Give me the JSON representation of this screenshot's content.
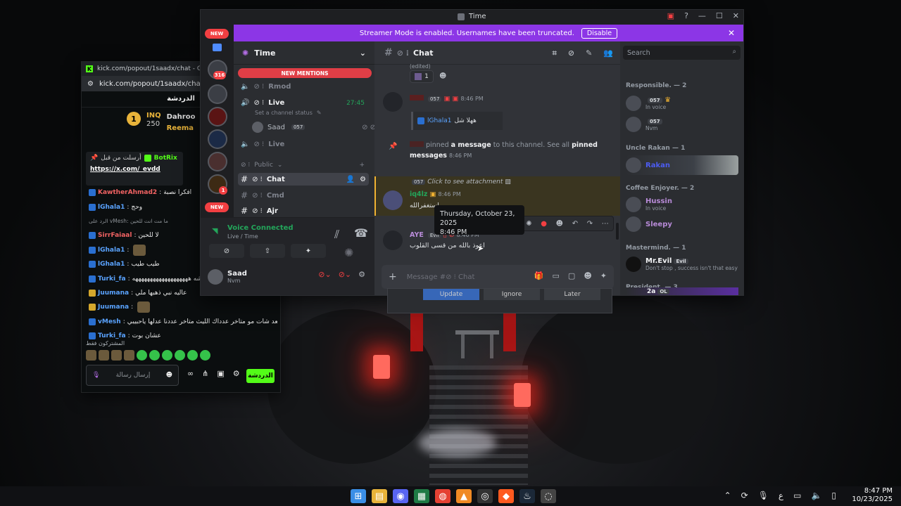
{
  "desktop": {
    "taskbar": {
      "icons": [
        "windows-start",
        "file-explorer",
        "discord",
        "excel",
        "chrome",
        "app-orange",
        "obs",
        "brave",
        "steam",
        "app-other"
      ],
      "tray": {
        "lang": "ع",
        "time": "8:47 PM",
        "date": "10/23/2025"
      }
    }
  },
  "kick": {
    "window_title": "kick.com/popout/1saadx/chat - Google Ch",
    "url": "kick.com/popout/1saadx/chat",
    "header": "الدردشة",
    "leaderboard": [
      {
        "rank": "1",
        "name": "INQ",
        "points": "250"
      },
      {
        "name": "Dahroo"
      },
      {
        "name": "Reema"
      }
    ],
    "pinned": {
      "from_label": "أرسلت من قبل",
      "user": "BotRix",
      "link": "https://x.com/_evdd"
    },
    "messages": [
      {
        "user": "KawtherAhmad2",
        "text": "افكرا نصبة",
        "color": "#f26363"
      },
      {
        "user": "lGhala1",
        "text": "وحج",
        "color": "#5aa3ff"
      },
      {
        "reply": "الرد على vMesh: ما مت انت للحين"
      },
      {
        "user": "SirrFaiaal",
        "text": "لا للحين",
        "color": "#f26363"
      },
      {
        "user": "lGhala1",
        "text": "",
        "color": "#5aa3ff"
      },
      {
        "user": "lGhala1",
        "text": "طيب طيب",
        "color": "#5aa3ff"
      },
      {
        "user": "Turki_fa",
        "text": "عايشه هههههههههههههههههههه",
        "color": "#5aa3ff"
      },
      {
        "user": "Juumana",
        "text": "عاليه نبي ذهبها ملي",
        "color": "#5aa3ff"
      },
      {
        "user": "Juumana",
        "text": "",
        "color": "#5aa3ff"
      },
      {
        "user": "vMesh",
        "text": "ياسعد شات مو متاخر عدداك الليث متاخر عددنا عدلها ياحبيبي",
        "color": "#5aa3ff"
      },
      {
        "user": "Turki_fa",
        "text": "عشان بوت",
        "color": "#5aa3ff"
      }
    ],
    "emotes_label": "المشتركون فقط",
    "input_placeholder": "إرسال رسالة",
    "send_label": "الدردشة"
  },
  "discord": {
    "title": "Time",
    "banner": {
      "text": "Streamer Mode is enabled. Usernames have been truncated.",
      "button": "Disable"
    },
    "guild_badges": {
      "new_top": "NEW",
      "count": "316",
      "red": "1",
      "new_bottom": "NEW"
    },
    "server_name": "Time",
    "new_mentions": "NEW MENTIONS",
    "channels": [
      {
        "name": "Rmod",
        "type": "voice"
      },
      {
        "name": "Live",
        "type": "voice",
        "time": "27:45",
        "status": "Set a channel status"
      },
      {
        "name": "Live",
        "type": "voice"
      },
      {
        "category": "Public"
      },
      {
        "name": "Chat",
        "type": "text",
        "active": true
      },
      {
        "name": "Cmd",
        "type": "text"
      },
      {
        "name": "Ajr",
        "type": "text"
      }
    ],
    "voice_member": {
      "name": "Saad",
      "tag": "057"
    },
    "voice": {
      "status": "Voice Connected",
      "channel": "Live / Time"
    },
    "user": {
      "name": "Saad",
      "status": "Nvm"
    },
    "chat": {
      "channel": "Chat",
      "edited": "(edited)",
      "reaction_count": "1",
      "messages": [
        {
          "tag": "057",
          "time": "8:46 PM",
          "reply_user": "lGhala1",
          "reply_text": "ههلا شل"
        },
        {
          "system": "pinned",
          "text_a": " pinned ",
          "text_b": "a message",
          "text_c": " to this channel. See all ",
          "text_d": "pinned",
          "text_e": "messages",
          "time": "8:46 PM"
        },
        {
          "user": "iq4lz",
          "attachment": "Click to see attachment",
          "time": "8:46 PM",
          "text": "استغفرالله"
        },
        {
          "user": "AYE",
          "tag": "Evil",
          "time": "8:46 PM",
          "text": "اعوذ بالله من قسى القلوب"
        }
      ],
      "tooltip": {
        "date": "Thursday, October 23, 2025",
        "time": "8:46 PM"
      },
      "composer_placeholder": "Message #⊘ ⁝ Chat"
    },
    "search_placeholder": "Search",
    "members": [
      {
        "role": "Responsible. — 2",
        "people": [
          {
            "name": "",
            "tag": "057",
            "sub": "In voice",
            "color": "#f23f42"
          },
          {
            "name": "",
            "tag": "057",
            "sub": "Nvm",
            "color": "#f23f42"
          }
        ]
      },
      {
        "role": "Uncle Rakan — 1",
        "people": [
          {
            "name": "Rakan",
            "sub": "",
            "color": "#4c5cf2"
          }
        ]
      },
      {
        "role": "Coffee Enjoyer. — 2",
        "people": [
          {
            "name": "Hussin",
            "sub": "In voice",
            "color": "#b88bd8"
          },
          {
            "name": "Sleepy",
            "sub": "",
            "color": "#b88bd8"
          }
        ]
      },
      {
        "role": "Mastermind. — 1",
        "people": [
          {
            "name": "Mr.Evil",
            "tag": "Evil",
            "sub": "Don't stop , success isn't that easy",
            "color": "#f2f3f5"
          }
        ]
      },
      {
        "role": "President. — 3",
        "people": [
          {
            "name": "2a",
            "tag": "OL",
            "sub": "",
            "color": "#f2f3f5"
          }
        ]
      }
    ],
    "update_dialog": {
      "update": "Update",
      "ignore": "Ignore",
      "later": "Later"
    }
  }
}
